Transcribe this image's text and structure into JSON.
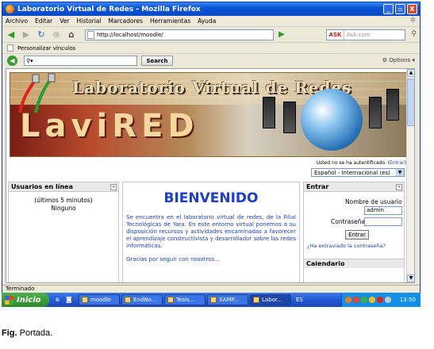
{
  "window": {
    "title": "Laboratorio Virtual de Redes - Mozilla Firefox",
    "buttons": [
      "_",
      "▫",
      "X"
    ]
  },
  "menu": [
    "Archivo",
    "Editar",
    "Ver",
    "Historial",
    "Marcadores",
    "Herramientas",
    "Ayuda"
  ],
  "nav": {
    "url": "http://localhost/moodle/",
    "search_engine": "ASK",
    "search_placeholder": "Ask.com"
  },
  "bookmarks": {
    "item": "Personalizar vínculos"
  },
  "toolbar2": {
    "search_value": "",
    "search_button": "Search",
    "options": "Options"
  },
  "banner": {
    "title": "Laboratorio Virtual de Redes",
    "big": "LaviRED"
  },
  "auth": {
    "text": "Usted no se ha autentificado. (",
    "link": "Entrar",
    "close": ")"
  },
  "language": {
    "selected": "Español - Internacional (es)"
  },
  "users_block": {
    "header": "Usuarios en línea",
    "line1": "(últimos 5 minutos)",
    "line2": "Ninguno"
  },
  "main": {
    "welcome": "BIENVENIDO",
    "paragraph": "Se encuentra en el laboratorio virtual de redes, de la Filial Tecnológicas de Yara. En este entorno virtual ponemos a su disposición recursos y actividades encaminadas a favorecer el aprendizaje constructivista y desarrollador sobre las redes informáticas.",
    "thanks": "Gracias por seguir con nosotros..."
  },
  "login_block": {
    "header": "Entrar",
    "username_label": "Nombre de usuario",
    "username_value": "admin",
    "password_label": "Contraseña",
    "password_value": "",
    "submit": "Entrar",
    "lost": "¿Ha extraviado la contraseña?",
    "calendar": "Calendario"
  },
  "statusbar": {
    "text": "Terminado"
  },
  "taskbar": {
    "start": "Inicio",
    "tasks": [
      "moodle",
      "EndNo...",
      "Tesis...",
      "XAMP...",
      "Labor..."
    ],
    "lang": "ES",
    "clock": "13:50"
  },
  "caption": {
    "bold": "Fig.",
    "text": " Portada."
  }
}
